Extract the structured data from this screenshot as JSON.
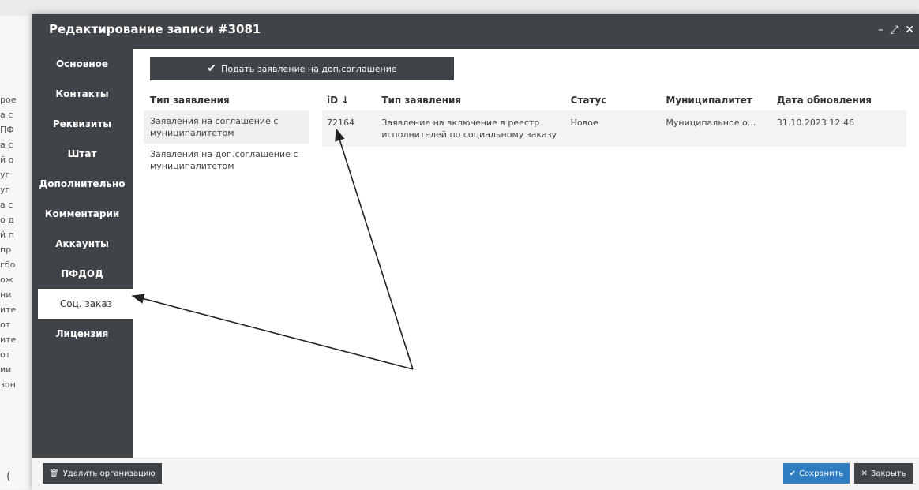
{
  "background": {
    "fragments": [
      "рое",
      "а с",
      "ПФ",
      "а с",
      "й о",
      "уг",
      "уг",
      "а с",
      "о д",
      "й п",
      "пр",
      "гбо",
      "ож",
      "ни",
      "ите",
      "от",
      "ите",
      "от",
      "ии",
      "зон"
    ],
    "stray_char": "("
  },
  "modal": {
    "title": "Редактирование записи #3081",
    "controls": {
      "minimize": "–",
      "maximize": "⤢",
      "close": "✕"
    }
  },
  "sidebar": {
    "items": [
      {
        "label": "Основное"
      },
      {
        "label": "Контакты"
      },
      {
        "label": "Реквизиты"
      },
      {
        "label": "Штат"
      },
      {
        "label": "Дополнительно"
      },
      {
        "label": "Комментарии"
      },
      {
        "label": "Аккаунты"
      },
      {
        "label": "ПФДОД"
      },
      {
        "label": "Соц. заказ"
      },
      {
        "label": "Лицензия"
      }
    ],
    "active_index": 8
  },
  "content": {
    "submit_button": {
      "icon": "check-icon",
      "label": "Подать заявление на доп.соглашение"
    },
    "type_list": {
      "header": "Тип заявления",
      "items": [
        "Заявления на соглашение с муниципалитетом",
        "Заявления на доп.соглашение с муниципалитетом"
      ],
      "selected_index": 0
    },
    "table": {
      "headers": {
        "id": "iD ↓",
        "type": "Тип заявления",
        "status": "Статус",
        "municipality": "Муниципалитет",
        "updated": "Дата обновления"
      },
      "rows": [
        {
          "id": "72164",
          "type": "Заявление на включение в реестр исполнителей по социальному заказу",
          "status": "Новое",
          "municipality": "Муниципальное о...",
          "updated": "31.10.2023 12:46"
        }
      ]
    }
  },
  "footer": {
    "delete_label": "Удалить организацию",
    "save_label": "Сохранить",
    "close_label": "Закрыть"
  },
  "colors": {
    "dark_panel": "#3f4449",
    "save_button": "#2f7cc1",
    "row_highlight": "#f3f3f3"
  }
}
